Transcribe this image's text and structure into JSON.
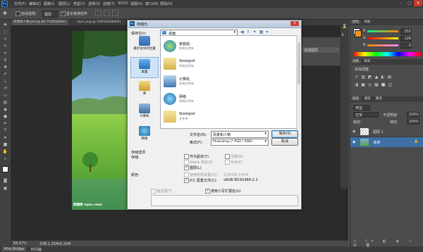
{
  "app": {
    "logo": "Ps"
  },
  "menu": [
    "文件(F)",
    "编辑(E)",
    "图像(I)",
    "图层(L)",
    "类型(Y)",
    "选择(S)",
    "滤镜(T)",
    "3D(D)",
    "视图(V)",
    "窗口(W)",
    "帮助(H)"
  ],
  "window_controls": {
    "min": "–",
    "max": "□",
    "close": "×"
  },
  "options": {
    "auto_select": "自动选择：",
    "layer_select": "图层",
    "show_transform": "显示变换控件"
  },
  "doc_tabs": [
    "风景和人物.psd @ 66.7%(RGB/8#)",
    "nipic.png @ 100%(RGB/8#)"
  ],
  "status": {
    "zoom": "66.67%",
    "doc": "文档:1.25M/6.25M"
  },
  "bottom": {
    "mini_bridge": "Mini Bridge",
    "timeline": "时间轴"
  },
  "photo_watermark": "昵图网 nipic.com/",
  "right_panels": {
    "swatch_tabs": [
      "颜色",
      "色板"
    ],
    "rgb": [
      {
        "ch": "R",
        "val": "255"
      },
      {
        "ch": "G",
        "val": "128"
      },
      {
        "ch": "B",
        "val": "0"
      }
    ],
    "adj_tabs": [
      "调整",
      "样式"
    ],
    "adj_title": "添加调整",
    "layers_tabs": [
      "图层",
      "通道",
      "路径"
    ],
    "kind_label": "类型",
    "blend": "正常",
    "opacity_label": "不透明度:",
    "opacity": "100%",
    "lock_label": "锁定:",
    "fill_label": "填充:",
    "fill": "100%",
    "layers": [
      {
        "name": "图层 1"
      },
      {
        "name": "背景"
      }
    ],
    "history_item": "选择图层"
  },
  "dialog": {
    "title": "存储为",
    "save_in_label": "保存在(I):",
    "save_in_value": "桌面",
    "places": [
      "最近访问的位置",
      "桌面",
      "库",
      "计算机",
      "网络"
    ],
    "files": [
      {
        "name": "家庭组",
        "desc": "系统文件夹"
      },
      {
        "name": "Steelgod",
        "desc": "系统文件夹"
      },
      {
        "name": "计算机",
        "desc": "系统文件夹"
      },
      {
        "name": "网络",
        "desc": "系统文件夹"
      },
      {
        "name": "Steelgod",
        "desc": "文件夹"
      }
    ],
    "filename_label": "文件名(N):",
    "filename_value": "风景和人物",
    "format_label": "格式(F):",
    "format_value": "Photoshop (*.PSD;*.PDD)",
    "save_btn": "保存(S)",
    "cancel_btn": "取消",
    "save_options_label": "存储选项",
    "store_label": "存储:",
    "opt_copy": "作为副本(Y)",
    "opt_notes": "注释(N)",
    "opt_alpha": "Alpha 通道(E)",
    "opt_spot": "专色(P)",
    "opt_layers": "图层(L)",
    "color_label": "颜色:",
    "opt_proof": "使用校样设置(O):",
    "opt_proof_value": "工作中的 CMYK",
    "opt_icc": "ICC 配置文件(C):",
    "opt_icc_value": "sRGB IEC61966-2.1",
    "opt_thumb": "缩览图(T)",
    "opt_ext": "使用小写扩展名(U)"
  }
}
